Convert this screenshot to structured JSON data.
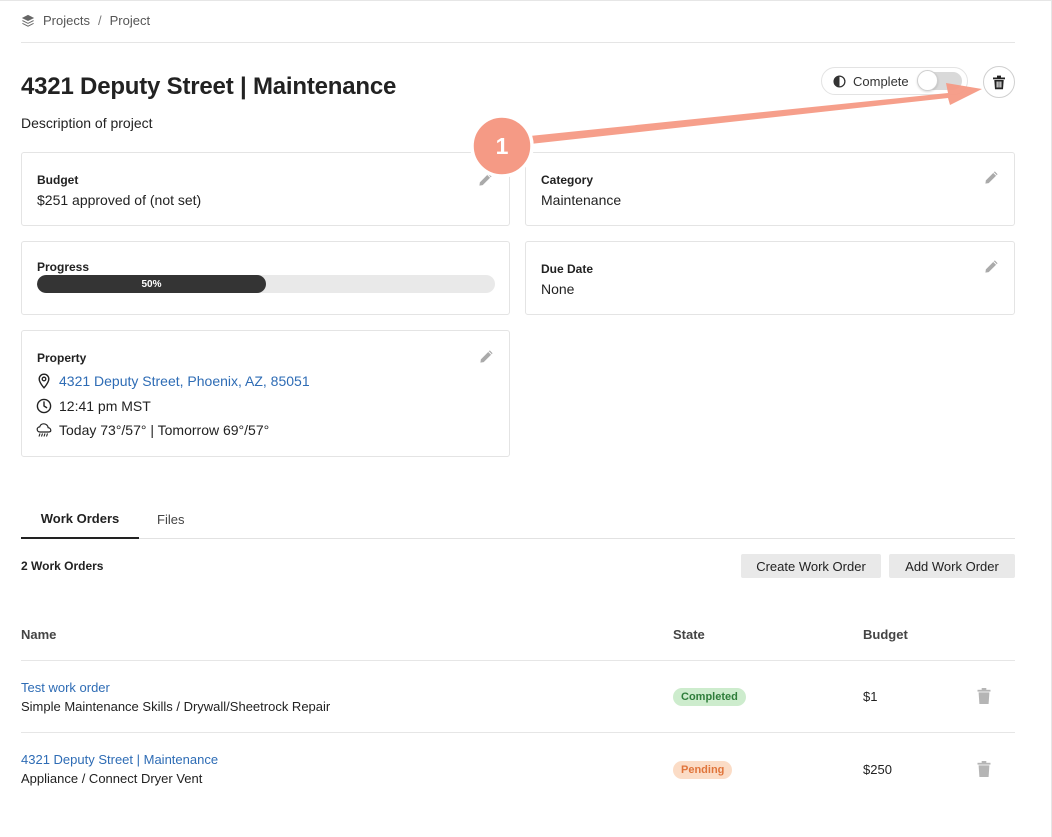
{
  "breadcrumb": {
    "items": [
      "Projects",
      "Project"
    ],
    "separator": "/"
  },
  "project": {
    "title": "4321 Deputy Street | Maintenance",
    "description": "Description of project",
    "complete_toggle": {
      "label": "Complete",
      "checked": false
    }
  },
  "cards": {
    "budget": {
      "label": "Budget",
      "value": "$251 approved of (not set)"
    },
    "category": {
      "label": "Category",
      "value": "Maintenance"
    },
    "progress": {
      "label": "Progress",
      "percent": 50,
      "text": "50%"
    },
    "due_date": {
      "label": "Due Date",
      "value": "None"
    },
    "property": {
      "label": "Property",
      "address": "4321 Deputy Street, Phoenix, AZ, 85051",
      "time": "12:41 pm MST",
      "weather": "Today 73°/57° | Tomorrow 69°/57°"
    }
  },
  "tabs": [
    {
      "label": "Work Orders",
      "active": true
    },
    {
      "label": "Files",
      "active": false
    }
  ],
  "work_orders": {
    "count_text": "2 Work Orders",
    "create_label": "Create Work Order",
    "add_label": "Add Work Order",
    "columns": [
      "Name",
      "State",
      "Budget"
    ],
    "rows": [
      {
        "name": "Test work order",
        "subtitle": "Simple Maintenance Skills / Drywall/Sheetrock Repair",
        "state": "Completed",
        "budget": "$1"
      },
      {
        "name": "4321 Deputy Street | Maintenance",
        "subtitle": "Appliance / Connect Dryer Vent",
        "state": "Pending",
        "budget": "$250"
      }
    ]
  },
  "annotation": {
    "step": "1",
    "color": "#f59a85"
  },
  "colors": {
    "link": "#2e6cb5",
    "progress_fill": "#343434",
    "completed_bg": "#cdeccd",
    "pending_bg": "#fbdcc6"
  },
  "icons": [
    "layers-icon",
    "contrast-icon",
    "trash-icon",
    "pencil-icon",
    "map-pin-icon",
    "clock-icon",
    "cloud-rain-icon"
  ]
}
